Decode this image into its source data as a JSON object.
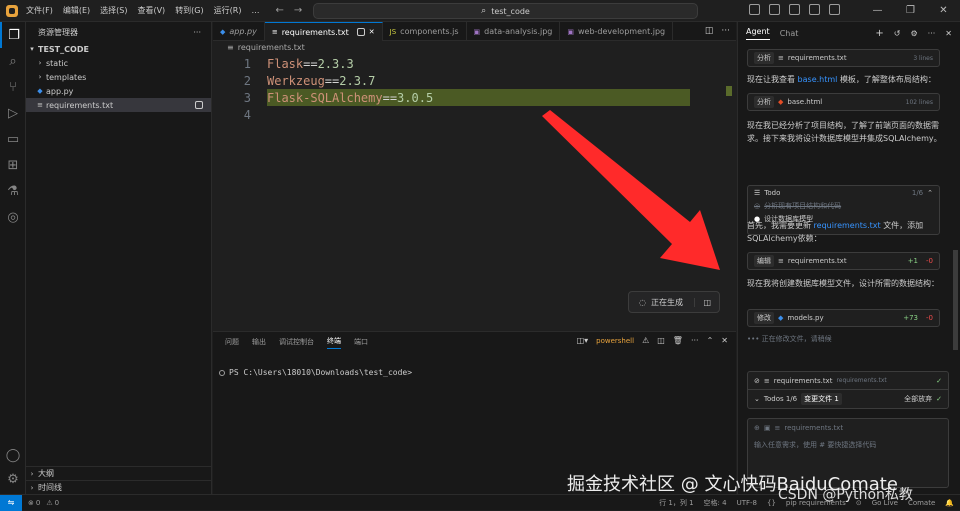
{
  "titlebar": {
    "menus": [
      "文件(F)",
      "编辑(E)",
      "选择(S)",
      "查看(V)",
      "转到(G)",
      "运行(R)",
      "…"
    ],
    "search": "test_code"
  },
  "sidebar": {
    "title": "资源管理器",
    "project": "TEST_CODE",
    "items": [
      {
        "label": "static",
        "type": "folder"
      },
      {
        "label": "templates",
        "type": "folder"
      },
      {
        "label": "app.py",
        "type": "py"
      },
      {
        "label": "requirements.txt",
        "type": "txt"
      }
    ],
    "outline": "大纲",
    "timeline": "时间线"
  },
  "tabs": [
    {
      "label": "app.py",
      "icon": "python-icon"
    },
    {
      "label": "requirements.txt",
      "icon": "text-file-icon"
    },
    {
      "label": "components.js",
      "icon": "js-icon"
    },
    {
      "label": "data-analysis.jpg",
      "icon": "image-icon"
    },
    {
      "label": "web-development.jpg",
      "icon": "image-icon"
    }
  ],
  "breadcrumb": "requirements.txt",
  "editor": {
    "lines": [
      {
        "n": "1",
        "key": "Flask",
        "op": "==",
        "ver": "2.3.3"
      },
      {
        "n": "2",
        "key": "Werkzeug",
        "op": "==",
        "ver": "2.3.7"
      },
      {
        "n": "3",
        "key": "Flask-SQLAlchemy",
        "op": "==",
        "ver": "3.0.5"
      },
      {
        "n": "4",
        "key": "",
        "op": "",
        "ver": ""
      }
    ],
    "generating": "正在生成"
  },
  "panel": {
    "tabs": [
      "问题",
      "输出",
      "调试控制台",
      "终端",
      "端口"
    ],
    "active": "终端",
    "shell": "powershell",
    "prompt": "PS C:\\Users\\18010\\Downloads\\test_code>"
  },
  "chat": {
    "tabs": [
      "Agent",
      "Chat"
    ],
    "card1": {
      "tag": "分析",
      "file": "requirements.txt",
      "meta": "3 lines"
    },
    "text1": "现在让我查看",
    "text1_link": "base.html",
    "text1_rest": "模板，了解整体布局结构：",
    "card2": {
      "tag": "分析",
      "file": "base.html",
      "meta": "102 lines"
    },
    "text2": "现在我已经分析了项目结构，了解了前端页面的数据需求。接下来我将设计数据库模型并集成SQLAlchemy。",
    "todo": {
      "title": "Todo",
      "count": "1/6",
      "done": "分析现有项目结构和代码",
      "current": "设计数据库模型"
    },
    "text3a": "首先，我需要更新",
    "text3_link": "requirements.txt",
    "text3b": "文件，添加SQLAlchemy依赖：",
    "card3": {
      "tag": "编辑",
      "file": "requirements.txt",
      "plus": "+1",
      "minus": "-0"
    },
    "text4": "现在我将创建数据库模型文件，设计所需的数据结构：",
    "card4": {
      "tag": "修改",
      "file": "models.py",
      "plus": "+73",
      "minus": "-0"
    },
    "status": "正在修改文件，请稍候",
    "changed_file": "requirements.txt",
    "changed_hint": "requirements.txt",
    "todos_label": "Todos 1/6",
    "changes_label": "变更文件 1",
    "discard_all": "全部放弃",
    "attach": "requirements.txt",
    "input_placeholder": "输入任意需求，使用 # 要快捷选择代码"
  },
  "statusbar": {
    "errors": "0",
    "warnings": "0",
    "position": "行 1，列 1",
    "spaces": "空格: 4",
    "encoding": "UTF-8",
    "lang": "pip requirements",
    "golive": "Go Live",
    "extra": "Comate"
  },
  "watermark": {
    "line1": "掘金技术社区 @ 文心快码BaiduComate",
    "line2": "CSDN @Python私教"
  },
  "colors": {
    "accent": "#0078d4",
    "highlight": "#4b5a24",
    "arrow": "#ff2a2a"
  }
}
